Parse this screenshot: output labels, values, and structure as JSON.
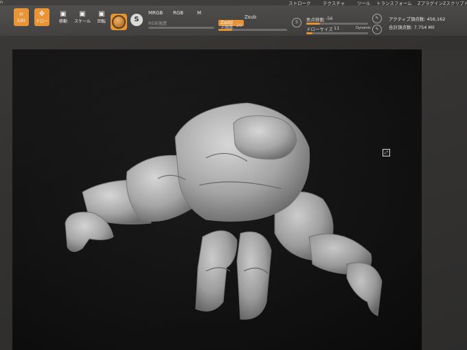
{
  "menu": {
    "items": [
      "ストローク",
      "テクスチャ",
      "ツール",
      "トランスフォーム",
      "Zプラグイン",
      "Zスクリプト"
    ]
  },
  "toolbar": {
    "edit_label": "Edit",
    "draw_label": "ドロー",
    "move_label": "移動",
    "scale_label": "スケール",
    "rotate_label": "回転",
    "mrgb": "MRGB",
    "rgb": "RGB",
    "m": "M",
    "rgb_intensity": "RGB強度",
    "zadd": "Zadd",
    "zsub": "Zsub",
    "z_intensity_label": "Z強度",
    "z_intensity_value": "20",
    "focal_shift_label": "焦点移動",
    "focal_shift_value": "-56",
    "draw_size_label": "ドローサイズ",
    "draw_size_value": "11",
    "dynamic": "Dynamic"
  },
  "stats": {
    "active_points": "アクティブ頂点数: 456,162",
    "total_points": "合計頂点数: 7.754 Mil"
  },
  "colors": {
    "accent": "#e8902f",
    "ui_bg": "#3d3c3b",
    "canvas": "#141414",
    "model": "#bdbdbd"
  },
  "icons": [
    "edit-icon",
    "draw-icon",
    "move-icon",
    "scale-icon",
    "rotate-icon",
    "material-icon",
    "s-icon",
    "frame-icon"
  ]
}
